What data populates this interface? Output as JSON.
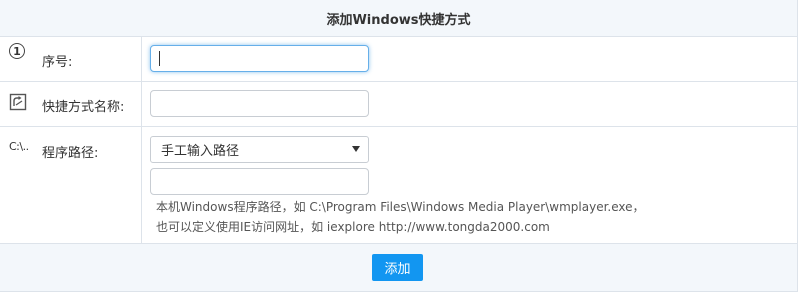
{
  "header": {
    "title": "添加Windows快捷方式"
  },
  "rows": {
    "order": {
      "icon": "circled-one-icon",
      "icon_glyph": "1",
      "label": "序号:",
      "value": ""
    },
    "name": {
      "icon": "shortcut-icon",
      "label": "快捷方式名称:",
      "value": ""
    },
    "path": {
      "icon": "path-icon",
      "icon_text": "C:\\..",
      "label": "程序路径:",
      "select_value": "手工输入路径",
      "input_value": "",
      "hint_line1": "本机Windows程序路径，如 C:\\Program Files\\Windows Media Player\\wmplayer.exe，",
      "hint_line2": "也可以定义使用IE访问网址，如 iexplore http://www.tongda2000.com"
    }
  },
  "footer": {
    "submit_label": "添加"
  },
  "colors": {
    "header_bg": "#f3f7fb",
    "border": "#dde3ea",
    "focus": "#66afe9",
    "button": "#1296f1"
  }
}
